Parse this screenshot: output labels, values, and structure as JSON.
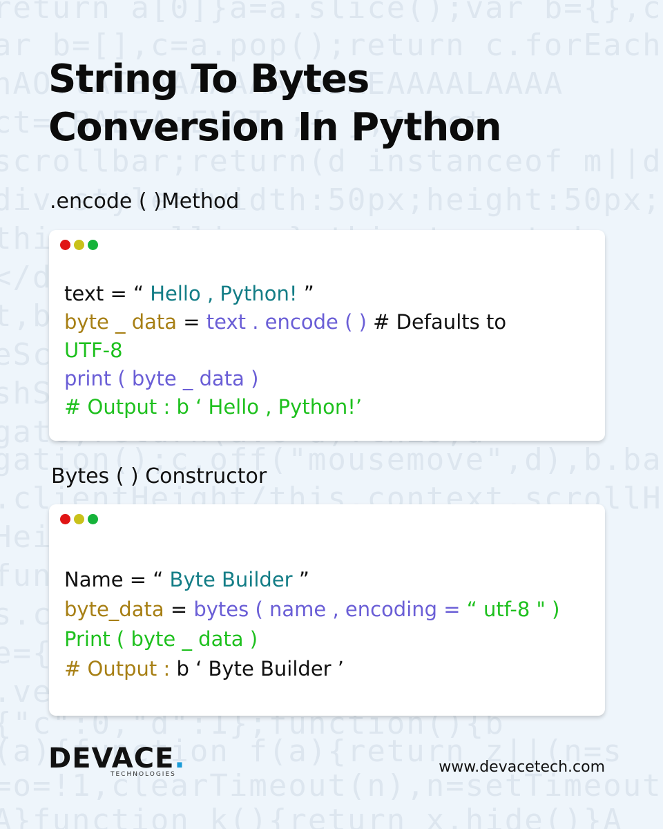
{
  "title": {
    "line1": "String To Bytes",
    "line2": "Conversion In Python"
  },
  "colors": {
    "background": "#eef5fb",
    "dot_red": "#e01515",
    "dot_yellow": "#c9c11a",
    "dot_green": "#16b33a",
    "code_teal": "#137d86",
    "code_gold": "#a77f14",
    "code_purple": "#6a5ed6",
    "code_green": "#1ec01e",
    "logo_dot": "#1a9bd7"
  },
  "section1": {
    "heading": ".encode ( )Method",
    "code": {
      "line1": {
        "a": "text = “ ",
        "b": "Hello , Python! ",
        "c": "”"
      },
      "line2": {
        "a": "byte _ data",
        "b": " = ",
        "c": "text . encode ( )",
        "d": "  # Defaults to"
      },
      "line3": "UTF-8",
      "line4": "print ( byte _ data )",
      "line5": "# Output : b ‘ Hello , Python!’"
    }
  },
  "section2": {
    "heading": "Bytes ( ) Constructor",
    "code": {
      "line1": {
        "a": "Name = “ ",
        "b": "Byte Builder ",
        "c": "”"
      },
      "line2": {
        "a": "byte_data",
        "b": " = ",
        "c": "bytes ( name , encoding = ",
        "d": "“ utf-8 \" )"
      },
      "line3": "Print ( byte _ data )",
      "line4": {
        "a": "# Output :",
        "b": " b ‘ Byte Builder ’"
      }
    }
  },
  "footer": {
    "logo": "DEVACE",
    "logo_dot": ".",
    "logo_sub": "TECHNOLOGIES",
    "website": "www.devacetech.com"
  }
}
